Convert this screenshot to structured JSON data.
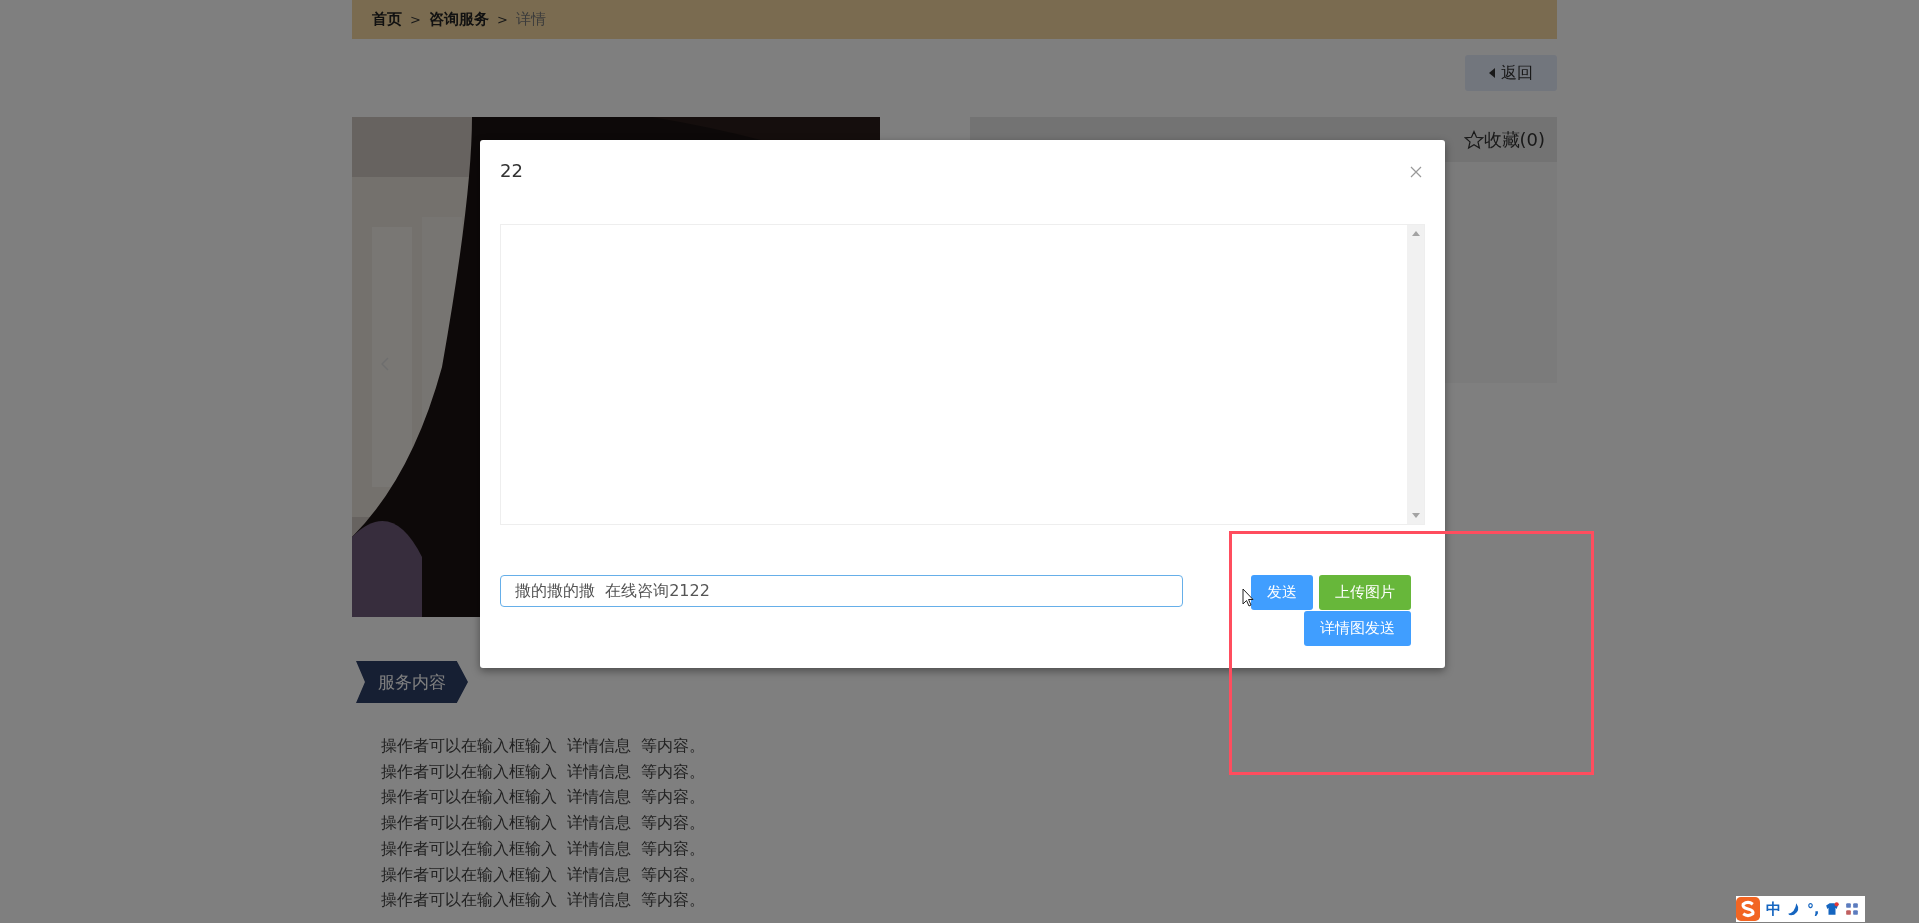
{
  "breadcrumb": [
    {
      "label": "首页",
      "current": false,
      "separator": ">"
    },
    {
      "label": "咨询服务",
      "current": false,
      "separator": ">"
    },
    {
      "label": "详情",
      "current": true
    }
  ],
  "back_button": {
    "label": "返回"
  },
  "detail_panel": {
    "favorite": "收藏(0)"
  },
  "section_tag": "服务内容",
  "description_lines": [
    "操作者可以在输入框输入  详情信息  等内容。",
    "操作者可以在输入框输入  详情信息  等内容。",
    "操作者可以在输入框输入  详情信息  等内容。",
    "操作者可以在输入框输入  详情信息  等内容。",
    "操作者可以在输入框输入  详情信息  等内容。",
    "操作者可以在输入框输入  详情信息  等内容。",
    "操作者可以在输入框输入  详情信息  等内容。"
  ],
  "dialog": {
    "title": "22",
    "input": {
      "value": "撒的撒的撒  在线咨询2122",
      "focused": true
    },
    "buttons": [
      {
        "label": "发送",
        "kind": "primary"
      },
      {
        "label": "上传图片",
        "kind": "success"
      },
      {
        "label": "详情图发送",
        "kind": "primary"
      }
    ]
  },
  "annotation": {
    "kind": "rectangle"
  },
  "ime_toolbar": {
    "mode": "中",
    "punctuation": "°,"
  }
}
